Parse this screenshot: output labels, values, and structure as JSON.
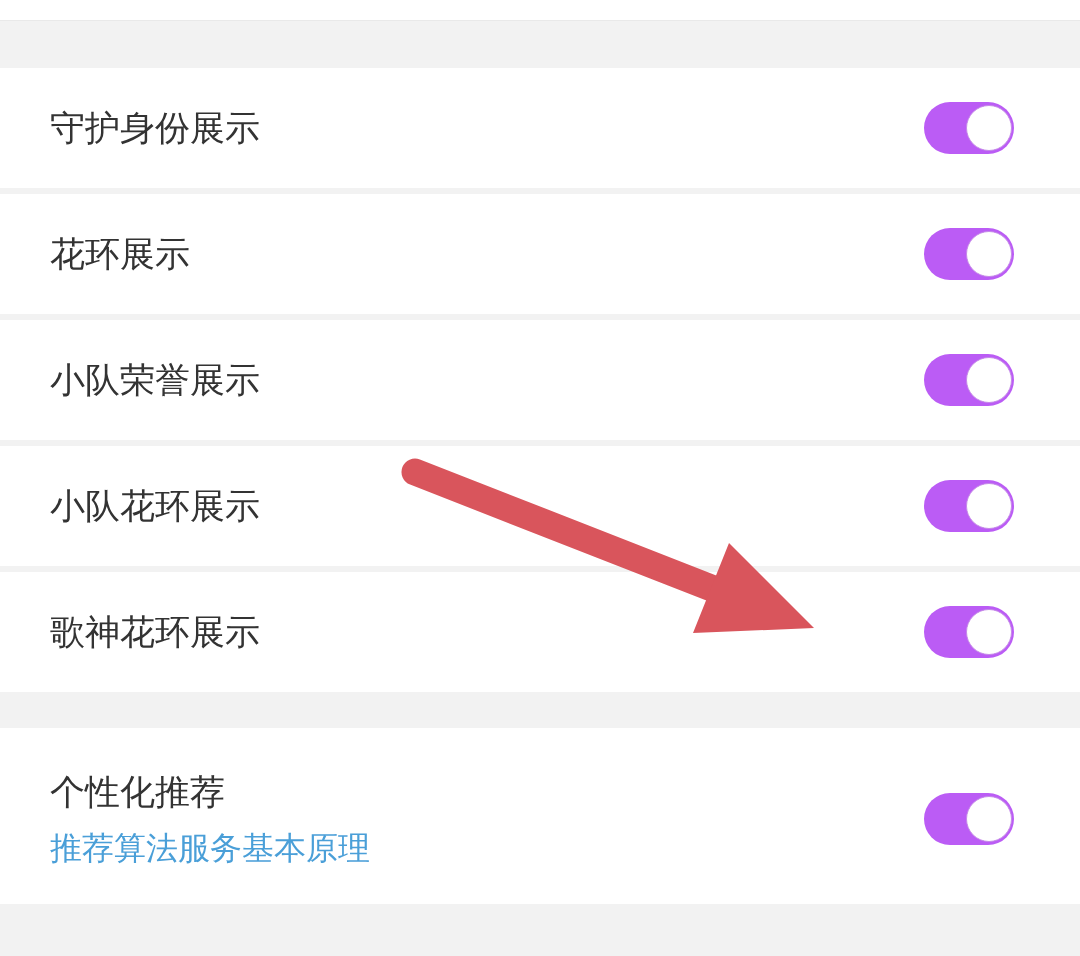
{
  "sections": [
    {
      "items": [
        {
          "label": "守护身份展示",
          "on": true
        },
        {
          "label": "花环展示",
          "on": true
        },
        {
          "label": "小队荣誉展示",
          "on": true
        },
        {
          "label": "小队花环展示",
          "on": true
        },
        {
          "label": "歌神花环展示",
          "on": true
        }
      ]
    },
    {
      "items": [
        {
          "label": "个性化推荐",
          "link": "推荐算法服务基本原理",
          "on": true
        }
      ]
    }
  ],
  "overlay": {
    "kind": "arrow"
  }
}
